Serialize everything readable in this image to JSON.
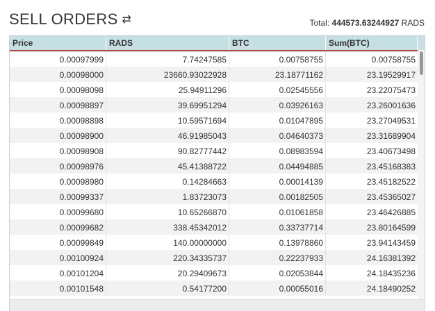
{
  "header": {
    "title": "SELL ORDERS",
    "swap_icon": "⇄",
    "total_label": "Total:",
    "total_value": "444573.63244927",
    "total_unit": "RADS"
  },
  "table": {
    "columns": [
      "Price",
      "RADS",
      "BTC",
      "Sum(BTC)"
    ],
    "rows": [
      [
        "0.00097999",
        "7.74247585",
        "0.00758755",
        "0.00758755"
      ],
      [
        "0.00098000",
        "23660.93022928",
        "23.18771162",
        "23.19529917"
      ],
      [
        "0.00098098",
        "25.94911296",
        "0.02545556",
        "23.22075473"
      ],
      [
        "0.00098897",
        "39.69951294",
        "0.03926163",
        "23.26001636"
      ],
      [
        "0.00098898",
        "10.59571694",
        "0.01047895",
        "23.27049531"
      ],
      [
        "0.00098900",
        "46.91985043",
        "0.04640373",
        "23.31689904"
      ],
      [
        "0.00098908",
        "90.82777442",
        "0.08983594",
        "23.40673498"
      ],
      [
        "0.00098976",
        "45.41388722",
        "0.04494885",
        "23.45168383"
      ],
      [
        "0.00098980",
        "0.14284663",
        "0.00014139",
        "23.45182522"
      ],
      [
        "0.00099337",
        "1.83723073",
        "0.00182505",
        "23.45365027"
      ],
      [
        "0.00099680",
        "10.65266870",
        "0.01061858",
        "23.46426885"
      ],
      [
        "0.00099682",
        "338.45342012",
        "0.33737714",
        "23.80164599"
      ],
      [
        "0.00099849",
        "140.00000000",
        "0.13978860",
        "23.94143459"
      ],
      [
        "0.00100924",
        "220.34335737",
        "0.22237933",
        "24.16381392"
      ],
      [
        "0.00101204",
        "20.29409673",
        "0.02053844",
        "24.18435236"
      ],
      [
        "0.00101548",
        "0.54177200",
        "0.00055016",
        "24.18490252"
      ]
    ]
  }
}
